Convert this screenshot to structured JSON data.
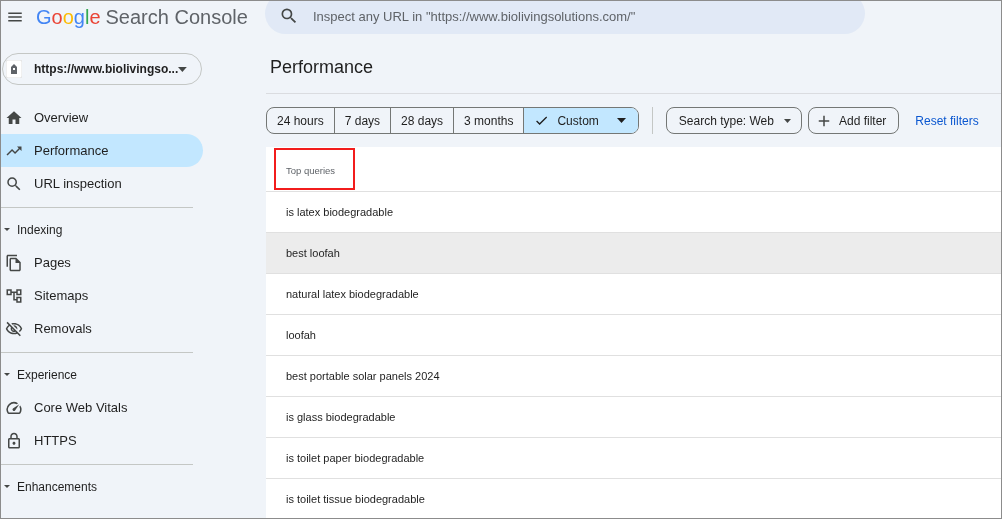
{
  "header": {
    "logo": {
      "brand": "Google",
      "product": "Search Console"
    },
    "search": {
      "placeholder": "Inspect any URL in \"https://www.biolivingsolutions.com/\""
    }
  },
  "sidebar": {
    "property": {
      "label": "https://www.biolivingso..."
    },
    "items": [
      {
        "label": "Overview",
        "selected": false
      },
      {
        "label": "Performance",
        "selected": true
      },
      {
        "label": "URL inspection",
        "selected": false
      }
    ],
    "sections": [
      {
        "label": "Indexing",
        "expanded": true,
        "children": [
          {
            "label": "Pages",
            "selected": false
          },
          {
            "label": "Sitemaps",
            "selected": false
          },
          {
            "label": "Removals",
            "selected": false
          }
        ]
      },
      {
        "label": "Experience",
        "expanded": true,
        "children": [
          {
            "label": "Core Web Vitals",
            "selected": false
          },
          {
            "label": "HTTPS",
            "selected": false
          }
        ]
      },
      {
        "label": "Enhancements",
        "expanded": true
      }
    ]
  },
  "page": {
    "title": "Performance"
  },
  "date_ranges": [
    {
      "kind": "preset",
      "label": "24 hours",
      "selected": false
    },
    {
      "kind": "preset",
      "label": "7 days",
      "selected": false
    },
    {
      "kind": "preset",
      "label": "28 days",
      "selected": false
    },
    {
      "kind": "preset",
      "label": "3 months",
      "selected": false
    },
    {
      "kind": "custom",
      "label": "Custom",
      "selected": true
    }
  ],
  "filters": [
    {
      "kind": "dropdown",
      "label": "Search type: Web"
    },
    {
      "kind": "add",
      "label": "Add filter"
    },
    {
      "kind": "link",
      "label": "Reset filters"
    }
  ],
  "table": {
    "column": {
      "label": "Top queries",
      "highlighted": true
    },
    "rows": [
      {
        "query": "is latex biodegradable",
        "hovered": false
      },
      {
        "query": "best loofah",
        "hovered": true
      },
      {
        "query": "natural latex biodegradable",
        "hovered": false
      },
      {
        "query": "loofah",
        "hovered": false
      },
      {
        "query": "best portable solar panels 2024",
        "hovered": false
      },
      {
        "query": "is glass biodegradable",
        "hovered": false
      },
      {
        "query": "is toilet paper biodegradable",
        "hovered": false
      },
      {
        "query": "is toilet tissue biodegradable",
        "hovered": false
      }
    ]
  }
}
